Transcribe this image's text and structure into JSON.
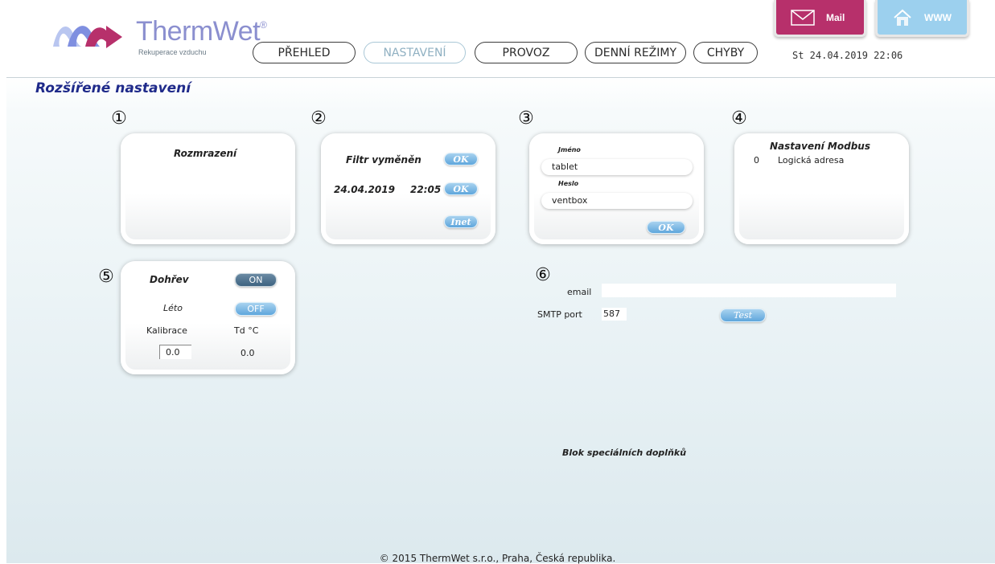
{
  "brand": {
    "name": "ThermWet",
    "reg": "®",
    "subtitle": "Rekuperace vzduchu",
    "color": "#8b8fcf"
  },
  "nav": {
    "items": [
      {
        "label": "PŘEHLED"
      },
      {
        "label": "NASTAVENÍ",
        "active": true
      },
      {
        "label": "PROVOZ"
      },
      {
        "label": "DENNÍ REŽIMY"
      },
      {
        "label": "CHYBY"
      }
    ]
  },
  "header": {
    "datetime": "St 24.04.2019  22:06",
    "mail_label": "Mail",
    "www_label": "WWW"
  },
  "page": {
    "title": "Rozšířené nastavení"
  },
  "sections": {
    "n1": "①",
    "n2": "②",
    "n3": "③",
    "n4": "④",
    "n5": "⑤",
    "n6": "⑥"
  },
  "defrost": {
    "title": "Rozmrazení"
  },
  "filter": {
    "title": "Filtr vyměněn",
    "ok1": "OK",
    "date": "24.04.2019",
    "time": "22:05",
    "ok2": "OK",
    "inet": "Inet"
  },
  "login": {
    "name_label": "Jméno",
    "name_value": "tablet",
    "password_label": "Heslo",
    "password_value": "ventbox",
    "ok": "OK"
  },
  "modbus": {
    "title": "Nastavení",
    "title2": "Modbus",
    "address_value": "0",
    "address_label": "Logická adresa"
  },
  "heating": {
    "label": "Dohřev",
    "state": "ON",
    "summer_label": "Léto",
    "summer_state": "OFF",
    "calibration_label": "Kalibrace",
    "td_label": "Td °C",
    "calibration_value": "0.0",
    "td_value": "0.0"
  },
  "email": {
    "email_label": "email",
    "email_value": "",
    "smtp_label": "SMTP port",
    "smtp_value": "587",
    "test_label": "Test"
  },
  "special": {
    "label": "Blok speciálních doplňků"
  },
  "footer": {
    "text": "© 2015 ThermWet s.r.o., Praha, Česká republika."
  }
}
